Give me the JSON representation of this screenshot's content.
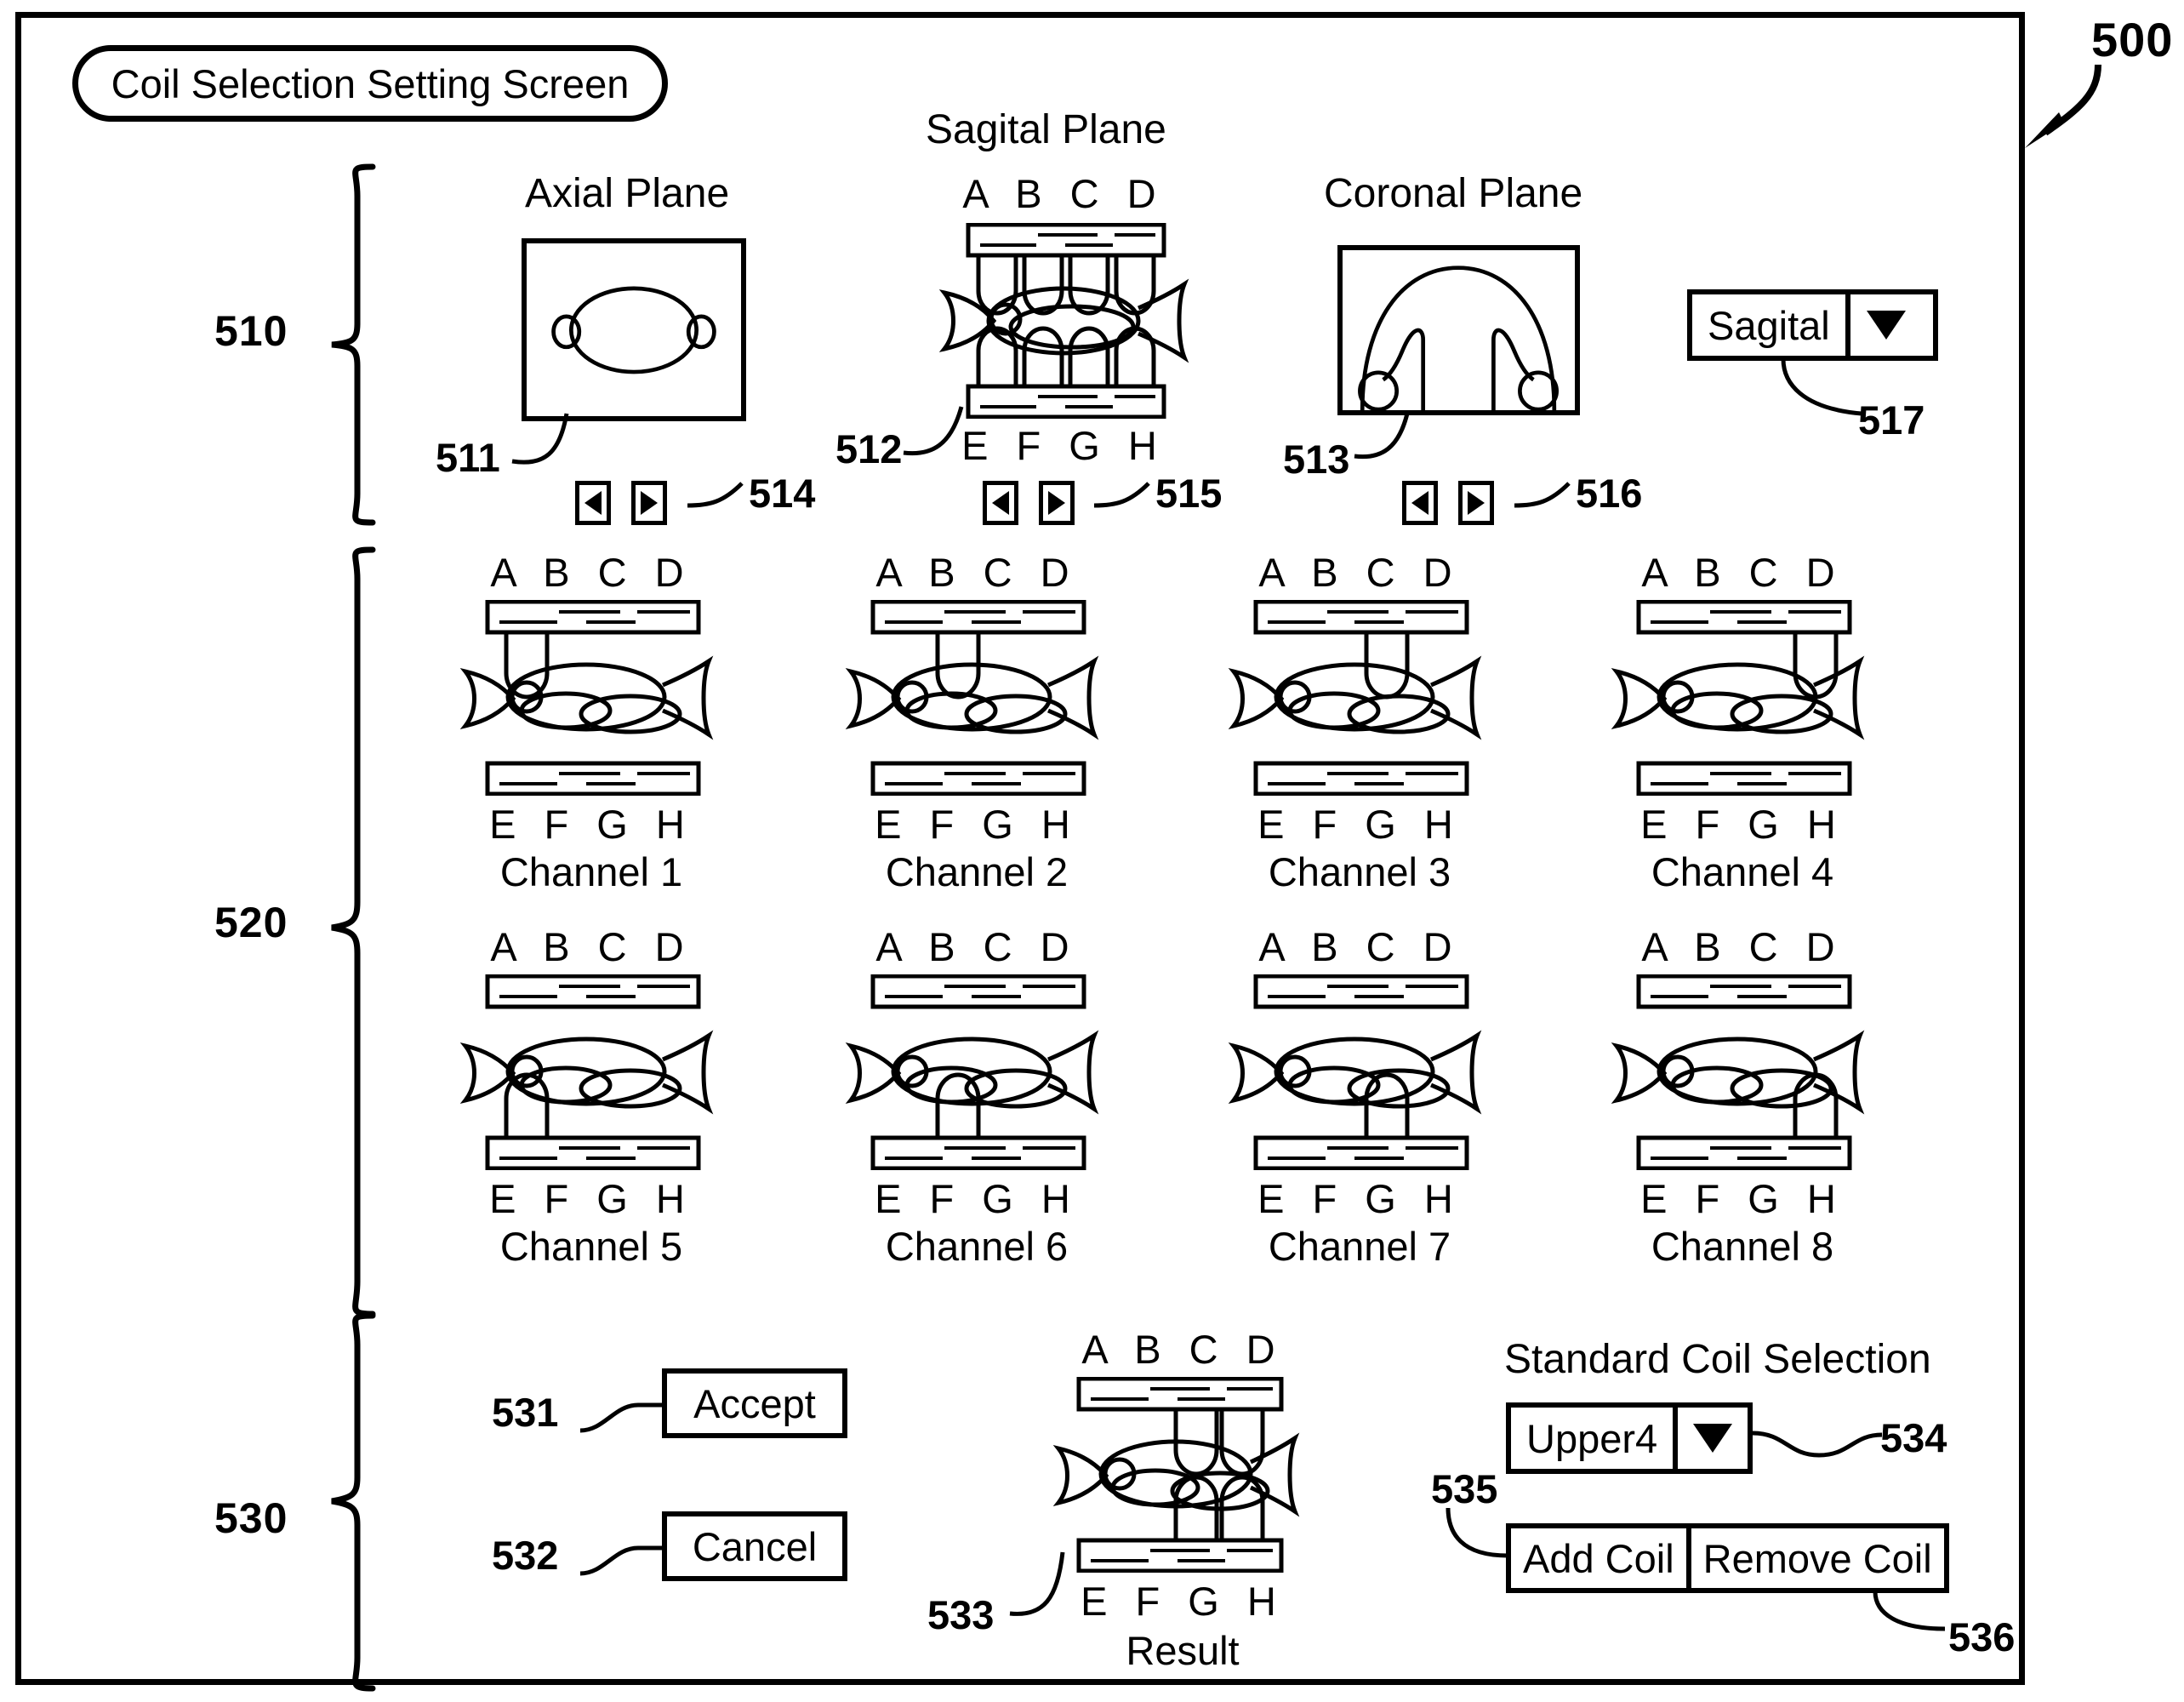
{
  "figure": {
    "ref_number": "500",
    "title": "Coil Selection Setting Screen"
  },
  "sections": {
    "planes": {
      "ref": "510",
      "axial": {
        "title": "Axial Plane",
        "ref": "511",
        "stepper_ref": "514",
        "prev_icon": "triangle-left-icon",
        "next_icon": "triangle-right-icon"
      },
      "sagital": {
        "title": "Sagital Plane",
        "ref": "512",
        "stepper_ref": "515",
        "top_letters": "A B C D",
        "bottom_letters": "E F G H",
        "prev_icon": "triangle-left-icon",
        "next_icon": "triangle-right-icon"
      },
      "coronal": {
        "title": "Coronal Plane",
        "ref": "513",
        "stepper_ref": "516",
        "prev_icon": "triangle-left-icon",
        "next_icon": "triangle-right-icon"
      },
      "plane_select": {
        "ref": "517",
        "value": "Sagital",
        "arrow_icon": "triangle-down-icon"
      }
    },
    "channels": {
      "ref": "520",
      "top_letters": "A B C D",
      "bottom_letters": "E F G H",
      "items": [
        {
          "caption": "Channel 1",
          "coil_position": "A",
          "coil_side": "top"
        },
        {
          "caption": "Channel 2",
          "coil_position": "B",
          "coil_side": "top"
        },
        {
          "caption": "Channel 3",
          "coil_position": "C",
          "coil_side": "top"
        },
        {
          "caption": "Channel 4",
          "coil_position": "D",
          "coil_side": "top"
        },
        {
          "caption": "Channel 5",
          "coil_position": "E",
          "coil_side": "bottom"
        },
        {
          "caption": "Channel 6",
          "coil_position": "F",
          "coil_side": "bottom"
        },
        {
          "caption": "Channel 7",
          "coil_position": "G",
          "coil_side": "bottom"
        },
        {
          "caption": "Channel 8",
          "coil_position": "H",
          "coil_side": "bottom"
        }
      ]
    },
    "actions": {
      "ref": "530",
      "accept": {
        "label": "Accept",
        "ref": "531"
      },
      "cancel": {
        "label": "Cancel",
        "ref": "532"
      },
      "result": {
        "caption": "Result",
        "ref": "533",
        "top_letters": "A B C D",
        "bottom_letters": "E F G H",
        "active_top": [
          "C",
          "D"
        ],
        "active_bottom": [
          "G",
          "H"
        ]
      },
      "standard_coil": {
        "heading": "Standard Coil Selection",
        "select": {
          "value": "Upper4",
          "ref": "534",
          "arrow_icon": "triangle-down-icon"
        },
        "add_label": "Add Coil",
        "remove_label": "Remove Coil",
        "add_ref": "535",
        "remove_ref": "536"
      }
    }
  }
}
